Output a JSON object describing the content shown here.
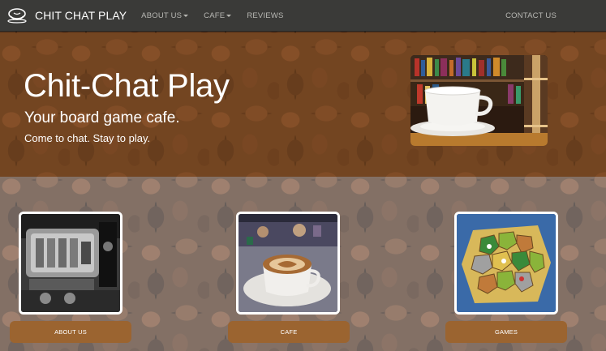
{
  "nav": {
    "brand": "CHIT CHAT PLAY",
    "links": [
      {
        "label": "ABOUT US",
        "dropdown": true
      },
      {
        "label": "CAFE",
        "dropdown": true
      },
      {
        "label": "REVIEWS",
        "dropdown": false
      }
    ],
    "contact": "CONTACT US"
  },
  "hero": {
    "title": "Chit-Chat Play",
    "subtitle": "Your board game cafe.",
    "tagline": "Come to chat. Stay to play."
  },
  "cards": [
    {
      "button": "ABOUT US"
    },
    {
      "button": "CAFE"
    },
    {
      "button": "GAMES"
    }
  ],
  "colors": {
    "navbar": "#3a3a38",
    "accent": "#9b6430",
    "hero_overlay": "#8c5528"
  }
}
